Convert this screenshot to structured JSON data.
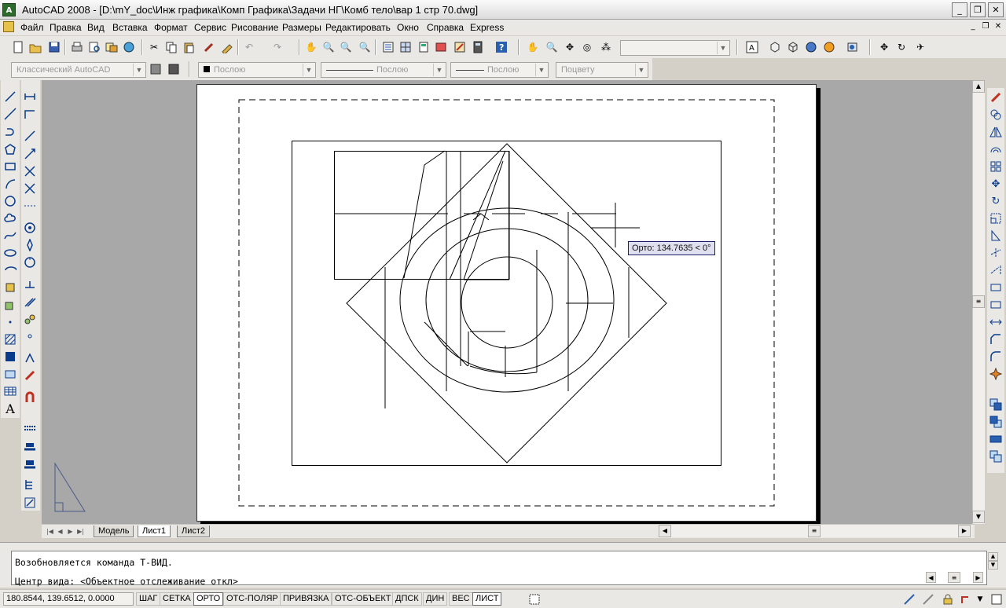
{
  "window": {
    "title": "AutoCAD 2008 - [D:\\mY_doc\\Инж графика\\Комп Графика\\Задачи НГ\\Комб тело\\вар 1 стр 70.dwg]",
    "app_icon": "A",
    "controls": [
      "_",
      "❐",
      "✕"
    ]
  },
  "menu": {
    "items": [
      "Файл",
      "Правка",
      "Вид",
      "Вставка",
      "Формат",
      "Сервис",
      "Рисование",
      "Размеры",
      "Редактировать",
      "Окно",
      "Справка",
      "Express"
    ],
    "mdi_controls": [
      "_",
      "❐",
      "✕"
    ]
  },
  "toolbar2": {
    "workspace": "Классический AutoCAD",
    "layer": "Послою",
    "linetype": "Послою",
    "lineweight": "Послою",
    "plotstyle": "Поцвету"
  },
  "tooltip": {
    "text": "Орто: 134.7635 < 0°"
  },
  "tabs": {
    "model": "Модель",
    "sheet1": "Лист1",
    "sheet2": "Лист2",
    "active": "Лист1"
  },
  "command": {
    "line1": "Возобновляется команда Т-ВИД.",
    "line2": "Центр вида:  <Объектное отслеживание откл>"
  },
  "status": {
    "coords": "180.8544, 139.6512, 0.0000",
    "buttons": [
      {
        "label": "ШАГ",
        "on": false
      },
      {
        "label": "СЕТКА",
        "on": false
      },
      {
        "label": "ОРТО",
        "on": true
      },
      {
        "label": "ОТС-ПОЛЯР",
        "on": false
      },
      {
        "label": "ПРИВЯЗКА",
        "on": false
      },
      {
        "label": "ОТС-ОБЪЕКТ",
        "on": false
      },
      {
        "label": "ДПСК",
        "on": false
      },
      {
        "label": "ДИН",
        "on": false
      },
      {
        "label": "ВЕС",
        "on": false
      },
      {
        "label": "ЛИСТ",
        "on": true
      }
    ]
  },
  "icons": {
    "ucs": "ucs-triangle-icon",
    "text_tool": "A"
  }
}
